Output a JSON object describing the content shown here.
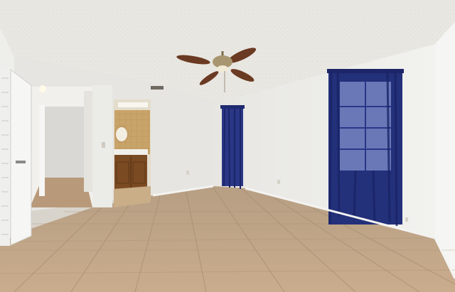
{
  "scene": {
    "subject": "empty-bedroom-interior",
    "palette": {
      "ceiling": "#e9e7e2",
      "wall": "#ecebe7",
      "wall_shadow": "#dcdad4",
      "floor": "#c4a98a",
      "grout": "#a88e70",
      "curtain": "#23307a",
      "curtain_light": "#3a4fb0",
      "door": "#f4f4f2",
      "vanity": "#7a4a22",
      "bath_tile": "#c9a46a",
      "fan_blade": "#6b3a22",
      "fan_body": "#a89670"
    },
    "features": [
      "textured-ceiling",
      "ceiling-fan-with-light",
      "left-open-door",
      "hallway-opening",
      "bathroom-doorway-with-vanity",
      "left-window-with-curtain",
      "right-window-with-curtain",
      "tile-floor"
    ]
  }
}
